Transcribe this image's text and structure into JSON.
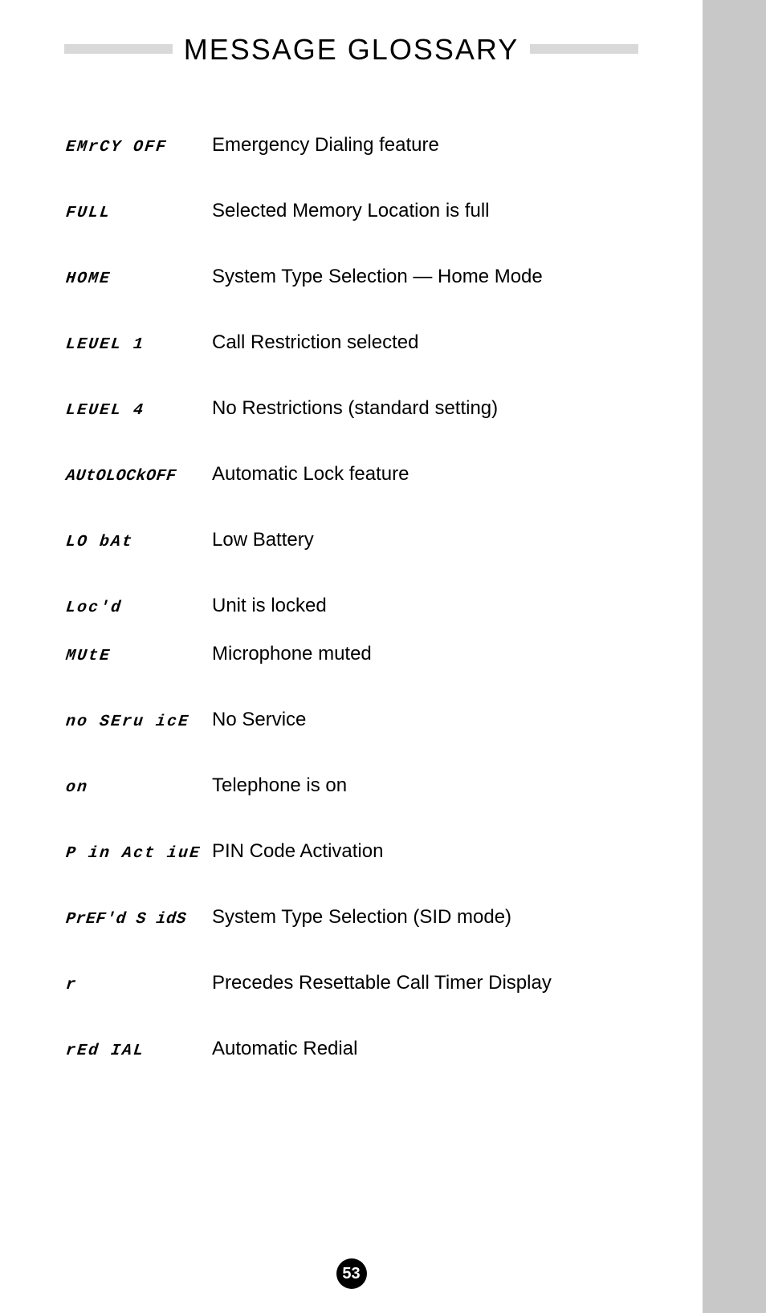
{
  "header": {
    "title": "MESSAGE GLOSSARY"
  },
  "glossary": [
    {
      "term": "EMrCY OFF",
      "desc": "Emergency Dialing feature"
    },
    {
      "term": "FULL",
      "desc": "Selected Memory Location is full"
    },
    {
      "term": "HOME",
      "desc": "System Type Selection — Home Mode"
    },
    {
      "term": "LEUEL 1",
      "desc": "Call Restriction selected"
    },
    {
      "term": "LEUEL 4",
      "desc": "No Restrictions (standard setting)"
    },
    {
      "term": "AUtOLOCkOFF",
      "desc": "Automatic Lock feature"
    },
    {
      "term": "LO bAt",
      "desc": "Low Battery"
    },
    {
      "term": "Loc'd",
      "desc": "Unit is locked"
    },
    {
      "term": "MUtE",
      "desc": "Microphone muted"
    },
    {
      "term": "no SEru icE",
      "desc": "No Service"
    },
    {
      "term": "on",
      "desc": "Telephone is on"
    },
    {
      "term": "P in Act iuE",
      "desc": "PIN Code Activation"
    },
    {
      "term": "PrEF'd S idS",
      "desc": "System Type Selection (SID mode)"
    },
    {
      "term": "r",
      "desc": "Precedes Resettable Call Timer Display"
    },
    {
      "term": "rEd IAL",
      "desc": "Automatic Redial"
    }
  ],
  "page_number": "53"
}
